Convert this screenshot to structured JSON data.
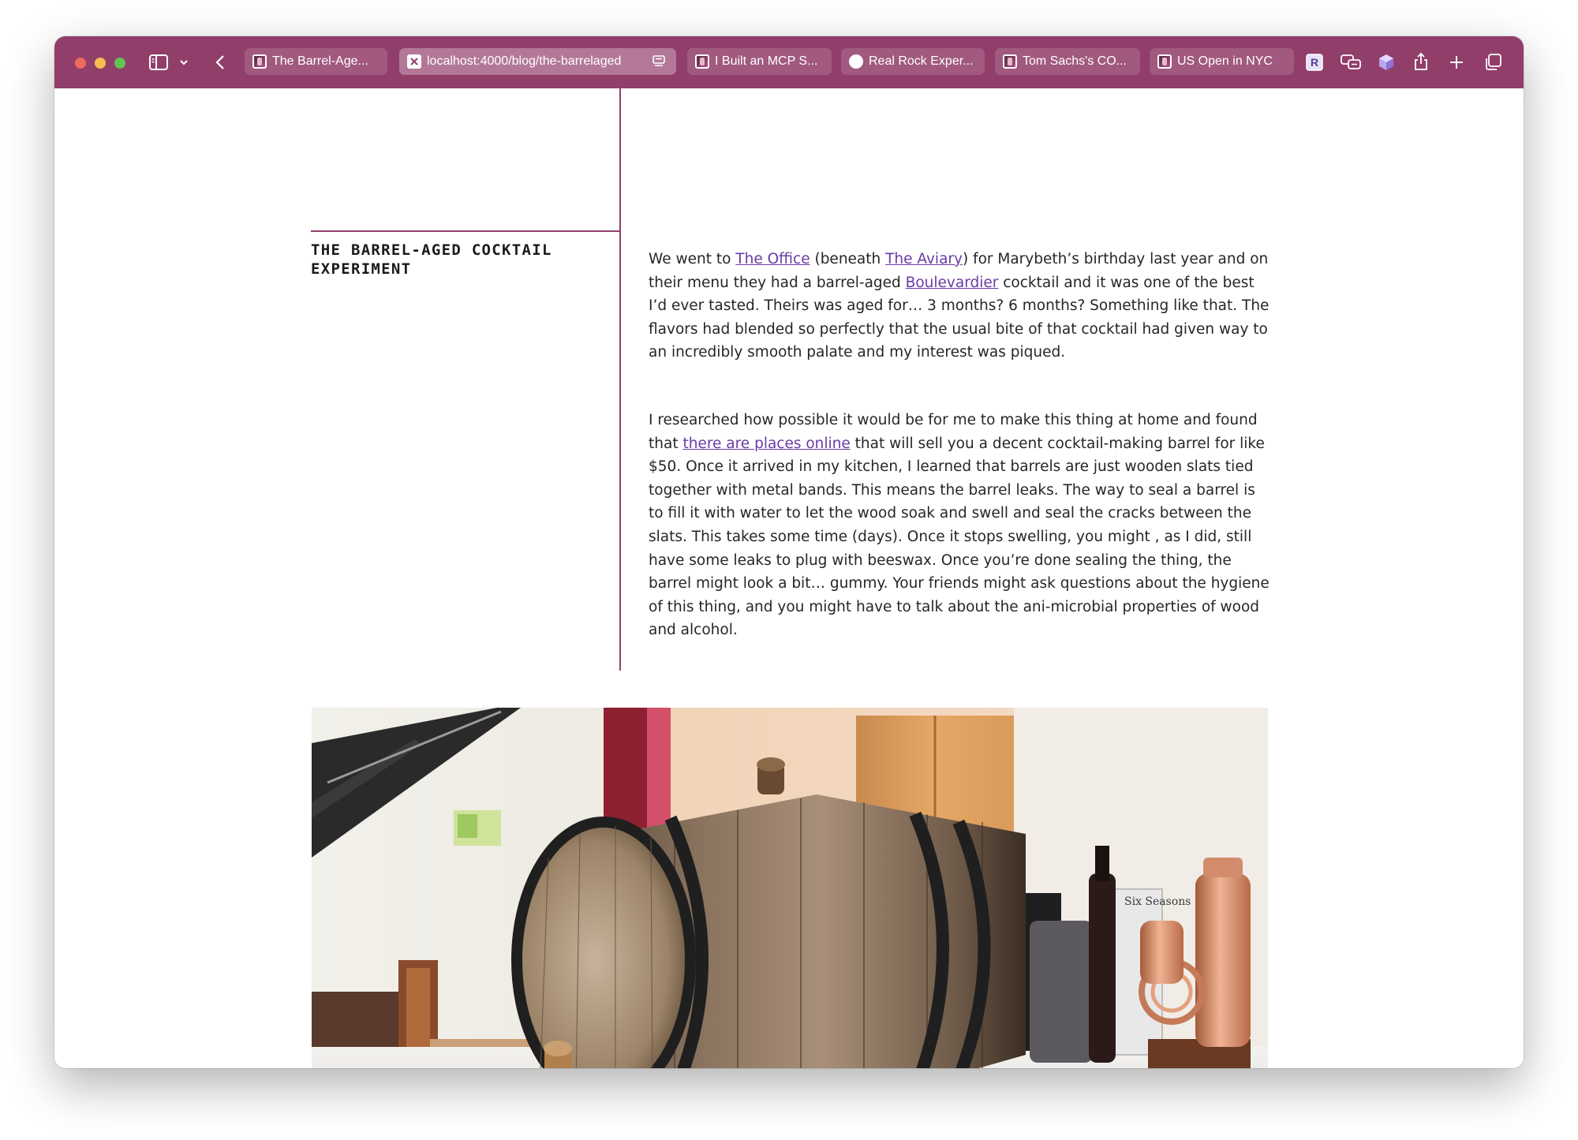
{
  "browser": {
    "tabs": [
      {
        "title": "The Barrel-Age...",
        "favicon": "site-favicon"
      },
      {
        "title": "localhost:4000/blog/the-barrelaged",
        "favicon": "close-tab-icon",
        "active": true
      },
      {
        "title": "I Built an MCP S...",
        "favicon": "site-favicon"
      },
      {
        "title": "Real Rock Exper...",
        "favicon": "dot-favicon"
      },
      {
        "title": "Tom Sachs's CO...",
        "favicon": "site-favicon"
      },
      {
        "title": "US Open in NYC",
        "favicon": "site-favicon"
      }
    ],
    "toolbar_icons": [
      "sidebar-icon",
      "chevron-down-icon",
      "back-icon",
      "reader-icon",
      "r-extension-icon",
      "translate-icon",
      "cube-extension-icon",
      "share-icon",
      "new-tab-icon",
      "tab-overview-icon"
    ],
    "accent_color": "#923e6b"
  },
  "article": {
    "title": "THE BARREL-AGED COCKTAIL EXPERIMENT",
    "p1": {
      "t1": "We went to ",
      "link1": "The Office",
      "t2": " (beneath ",
      "link2": "The Aviary",
      "t3": ") for Marybeth’s birthday last year and on their menu they had a barrel-aged ",
      "link3": "Boulevardier",
      "t4": " cocktail and it was one of the best I’d ever tasted. Theirs was aged for… 3 months? 6 months? Something like that. The flavors had blended so perfectly that the usual bite of that cocktail had given way to an incredibly smooth palate and my interest was piqued."
    },
    "p2": {
      "t1": "I researched how possible it would be for me to make this thing at home and found that ",
      "link1": "there are places online",
      "t2": " that will sell you a decent cocktail-making barrel for like $50. Once it arrived in my kitchen, I learned that barrels are just wooden slats tied together with metal bands. This means the barrel leaks. The way to seal a barrel is to fill it with water to let the wood soak and swell and seal the cracks between the slats. This takes some time (days). Once it stops swelling, you might , as I did, still have some leaks to plug with beeswax. Once you’re done sealing the thing, the barrel might look a bit… gummy. Your friends might ask questions about the hygiene of this thing, and you might have to talk about the ani-microbial properties of wood and alcohol."
    },
    "photo": {
      "book_spine_text": "Six Seasons"
    }
  }
}
